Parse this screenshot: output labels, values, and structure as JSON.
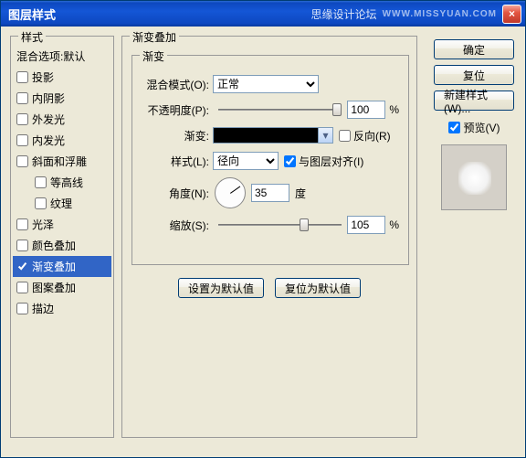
{
  "titlebar": {
    "title": "图层样式",
    "watermark": "思缘设计论坛",
    "watermark2": "WWW.MISSYUAN.COM",
    "close": "×"
  },
  "left": {
    "legend": "样式",
    "header": "混合选项:默认",
    "items": [
      {
        "label": "投影",
        "checked": false
      },
      {
        "label": "内阴影",
        "checked": false
      },
      {
        "label": "外发光",
        "checked": false
      },
      {
        "label": "内发光",
        "checked": false
      },
      {
        "label": "斜面和浮雕",
        "checked": false
      },
      {
        "label": "等高线",
        "checked": false,
        "indent": true
      },
      {
        "label": "纹理",
        "checked": false,
        "indent": true
      },
      {
        "label": "光泽",
        "checked": false
      },
      {
        "label": "颜色叠加",
        "checked": false
      },
      {
        "label": "渐变叠加",
        "checked": true,
        "selected": true
      },
      {
        "label": "图案叠加",
        "checked": false
      },
      {
        "label": "描边",
        "checked": false
      }
    ]
  },
  "main": {
    "legend": "渐变叠加",
    "inner_legend": "渐变",
    "blend_label": "混合模式(O):",
    "blend_value": "正常",
    "opacity_label": "不透明度(P):",
    "opacity_value": "100",
    "opacity_unit": "%",
    "gradient_label": "渐变:",
    "reverse_label": "反向(R)",
    "style_label": "样式(L):",
    "style_value": "径向",
    "align_label": "与图层对齐(I)",
    "angle_label": "角度(N):",
    "angle_value": "35",
    "angle_unit": "度",
    "scale_label": "缩放(S):",
    "scale_value": "105",
    "scale_unit": "%",
    "btn_default": "设置为默认值",
    "btn_reset": "复位为默认值"
  },
  "right": {
    "ok": "确定",
    "cancel": "复位",
    "newstyle": "新建样式(W)...",
    "preview_label": "预览(V)"
  }
}
